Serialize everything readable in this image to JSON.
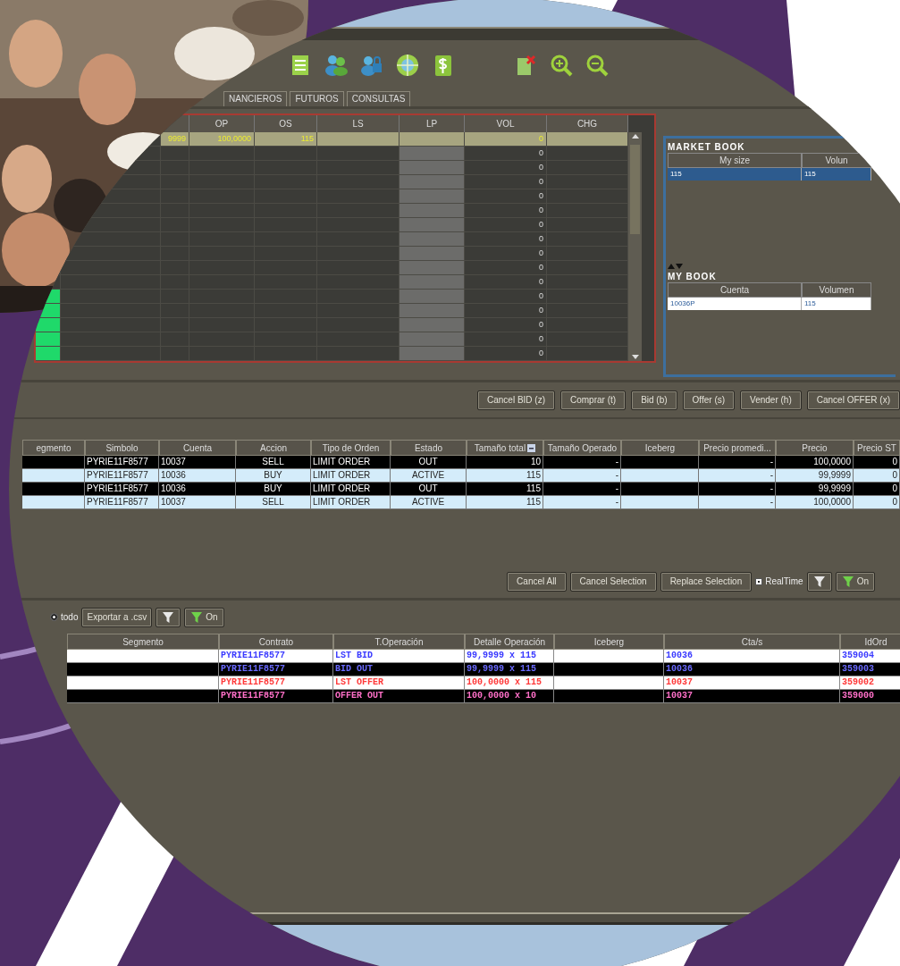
{
  "tabs": [
    {
      "label": "NANCIEROS",
      "selected": false
    },
    {
      "label": "FUTUROS",
      "selected": false
    },
    {
      "label": "CONSULTAS",
      "selected": false
    }
  ],
  "quote_grid": {
    "columns": [
      "OP",
      "OS",
      "LS",
      "LP",
      "VOL",
      "CHG"
    ],
    "rows": [
      {
        "column_3": "9999",
        "op": "100,0000",
        "os": "115",
        "vol": "0",
        "selected": true
      },
      {
        "vol": "0",
        "selected": false
      },
      {
        "vol": "0",
        "selected": false
      },
      {
        "vol": "0",
        "selected": false
      },
      {
        "vol": "0",
        "selected": false
      },
      {
        "vol": "0",
        "selected": false
      },
      {
        "vol": "0",
        "selected": false
      },
      {
        "vol": "0",
        "selected": false
      },
      {
        "vol": "0",
        "selected": false
      },
      {
        "vol": "0",
        "selected": false
      },
      {
        "vol": "0",
        "selected": false
      },
      {
        "vol": "0",
        "selected": false,
        "flagged": true
      },
      {
        "vol": "0",
        "selected": false,
        "flagged": true
      },
      {
        "vol": "0",
        "selected": false,
        "flagged": true
      },
      {
        "vol": "0",
        "selected": false,
        "flagged": true
      },
      {
        "vol": "0",
        "selected": false,
        "flagged": true
      }
    ]
  },
  "market_book": {
    "title": "MARKET BOOK",
    "columns": [
      "My size",
      "Volun"
    ],
    "rows": [
      {
        "cells": [
          "115",
          "115"
        ],
        "selected": true
      }
    ]
  },
  "my_book": {
    "title": "MY BOOK",
    "columns": [
      "Cuenta",
      "Volumen"
    ],
    "rows": [
      {
        "cells": [
          "10036P",
          "115"
        ],
        "selected": false
      }
    ]
  },
  "order_buttons": [
    "Cancel BID (z)",
    "Comprar (t)",
    "Bid (b)",
    "Offer (s)",
    "Vender (h)",
    "Cancel OFFER (x)"
  ],
  "orders": {
    "columns": [
      "egmento",
      "Simbolo",
      "Cuenta",
      "Accion",
      "Tipo de Orden",
      "Estado",
      "Tamaño total",
      "Tamaño Operado",
      "Iceberg",
      "Precio promedi...",
      "Precio",
      "Precio ST"
    ],
    "rows": [
      {
        "dark": true,
        "cells": [
          null,
          "PYRIE11F8577",
          "10037",
          "SELL",
          "LIMIT ORDER",
          "OUT",
          "10",
          "-",
          null,
          "-",
          "100,0000",
          "0"
        ]
      },
      {
        "dark": false,
        "cells": [
          null,
          "PYRIE11F8577",
          "10036",
          "BUY",
          "LIMIT ORDER",
          "ACTIVE",
          "115",
          "-",
          null,
          "-",
          "99,9999",
          "0"
        ]
      },
      {
        "dark": true,
        "cells": [
          null,
          "PYRIE11F8577",
          "10036",
          "BUY",
          "LIMIT ORDER",
          "OUT",
          "115",
          "-",
          null,
          "-",
          "99,9999",
          "0"
        ]
      },
      {
        "dark": false,
        "cells": [
          null,
          "PYRIE11F8577",
          "10037",
          "SELL",
          "LIMIT ORDER",
          "ACTIVE",
          "115",
          "-",
          null,
          "-",
          "100,0000",
          "0"
        ]
      }
    ]
  },
  "order_actions": {
    "buttons": [
      "Cancel All",
      "Cancel Selection",
      "Replace Selection"
    ],
    "realtime": {
      "label": "RealTime",
      "checked": true
    },
    "filter_on": "On"
  },
  "trade_filter": {
    "radio": {
      "label": "todo",
      "selected": true
    },
    "export": "Exportar a .csv",
    "filter_on": "On"
  },
  "trades": {
    "columns": [
      "Segmento",
      "Contrato",
      "T.Operación",
      "Detalle Operación",
      "Iceberg",
      "Cta/s",
      "IdOrd"
    ],
    "rows": [
      {
        "dark": false,
        "color": "#3a3aff",
        "cells": [
          null,
          "PYRIE11F8577",
          "LST BID",
          "99,9999 x 115",
          null,
          "10036",
          "359004"
        ]
      },
      {
        "dark": true,
        "color": "#6a6aff",
        "cells": [
          null,
          "PYRIE11F8577",
          "BID OUT",
          "99,9999 x 115",
          null,
          "10036",
          "359003"
        ]
      },
      {
        "dark": false,
        "color": "#ff3a3a",
        "cells": [
          null,
          "PYRIE11F8577",
          "LST OFFER",
          "100,0000 x 115",
          null,
          "10037",
          "359002"
        ]
      },
      {
        "dark": true,
        "color": "#ff70c8",
        "cells": [
          null,
          "PYRIE11F8577",
          "OFFER OUT",
          "100,0000 x 10",
          null,
          "10037",
          "359000"
        ]
      }
    ]
  }
}
